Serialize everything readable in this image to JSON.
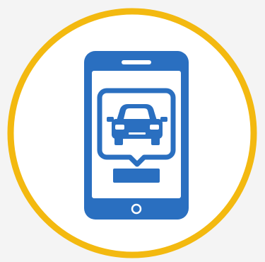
{
  "icon": {
    "name": "mobile-car-booking-icon",
    "ring_icon": "yellow-ring",
    "phone_icon": "smartphone-icon",
    "car_icon": "car-icon"
  },
  "colors": {
    "background": "#f4f4f4",
    "circle_fill": "#ffffff",
    "ring": "#f3b910",
    "phone": "#2a6fc0",
    "phone_screen": "#ffffff"
  }
}
